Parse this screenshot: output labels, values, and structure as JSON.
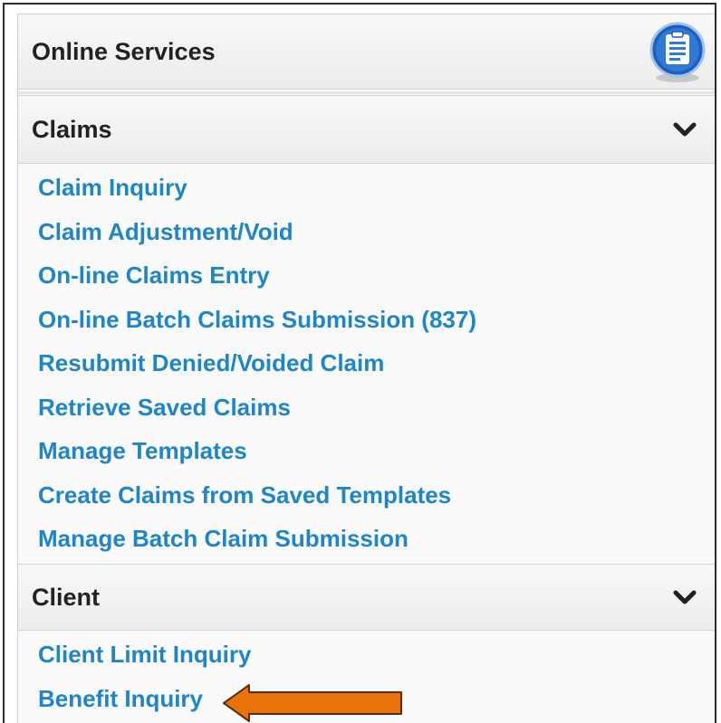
{
  "header": {
    "title": "Online Services",
    "icon": "document-icon"
  },
  "sections": {
    "claims": {
      "title": "Claims",
      "links": [
        "Claim Inquiry",
        "Claim Adjustment/Void",
        "On-line Claims Entry",
        "On-line Batch Claims Submission (837)",
        "Resubmit Denied/Voided Claim",
        "Retrieve Saved Claims",
        "Manage Templates",
        "Create Claims from Saved Templates",
        "Manage Batch Claim Submission"
      ]
    },
    "client": {
      "title": "Client",
      "links": [
        "Client Limit Inquiry",
        "Benefit Inquiry"
      ]
    }
  },
  "colors": {
    "link": "#1e85c6",
    "arrow": "#e8730c",
    "icon": "#2a6fc4"
  }
}
